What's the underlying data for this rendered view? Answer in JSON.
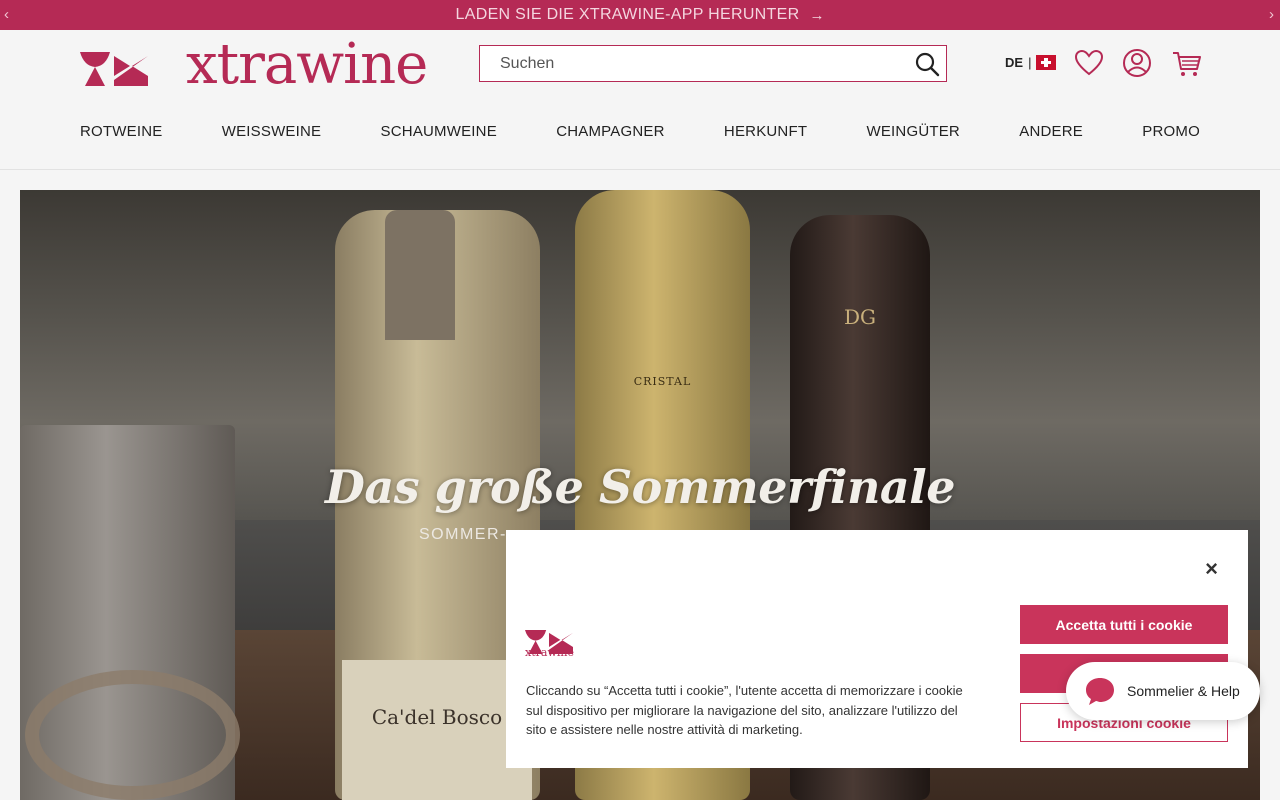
{
  "banner": {
    "text": "LADEN SIE DIE XTRAWINE-APP HERUNTER",
    "prev": "‹",
    "next": "›",
    "arrow": "→"
  },
  "header": {
    "logo_text": "xtrawine",
    "search_placeholder": "Suchen",
    "language": "DE",
    "language_separator": "|",
    "icons": [
      "search-icon",
      "flag-switzerland-icon",
      "heart-icon",
      "user-icon",
      "cart-icon"
    ]
  },
  "nav": [
    "ROTWEINE",
    "WEISSWEINE",
    "SCHAUMWEINE",
    "CHAMPAGNER",
    "HERKUNFT",
    "WEINGÜTER",
    "ANDERE",
    "PROMO"
  ],
  "hero": {
    "title": "Das große Sommerfinale",
    "subtitle": "SOMMER-",
    "bottle_labels": {
      "left": "Ca'del Bosco",
      "middle": "CRISTAL",
      "right": "DG"
    }
  },
  "cookie": {
    "logo_text": "xtrawine",
    "close": "×",
    "text": "Cliccando su “Accetta tutti i cookie”, l'utente accetta di memorizzare i cookie sul dispositivo per migliorare la navigazione del sito, analizzare l'utilizzo del sito e assistere nelle nostre attività di marketing.",
    "accept_all": "Accetta tutti i cookie",
    "settings": "Impostazioni cookie"
  },
  "help": {
    "label": "Sommelier & Help"
  },
  "colors": {
    "brand": "#b52a55",
    "button": "#c9345b"
  }
}
